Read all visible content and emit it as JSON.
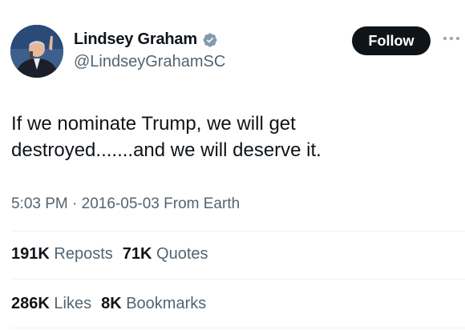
{
  "author": {
    "name": "Lindsey Graham",
    "handle": "@LindseyGrahamSC",
    "verified": true
  },
  "actions": {
    "follow_label": "Follow",
    "more_icon": "more-icon"
  },
  "tweet": {
    "text": "If we nominate Trump, we will get\ndestroyed.......and we will deserve it.",
    "time": "5:03 PM",
    "date": "2016-05-03",
    "location": "From Earth",
    "separator": "·"
  },
  "stats_row1": [
    {
      "count": "191K",
      "label": "Reposts"
    },
    {
      "count": "71K",
      "label": "Quotes"
    }
  ],
  "stats_row2": [
    {
      "count": "286K",
      "label": "Likes"
    },
    {
      "count": "8K",
      "label": "Bookmarks"
    }
  ],
  "colors": {
    "text": "#0f1419",
    "muted": "#536471",
    "verified": "#829aab",
    "divider": "#eff3f4"
  }
}
